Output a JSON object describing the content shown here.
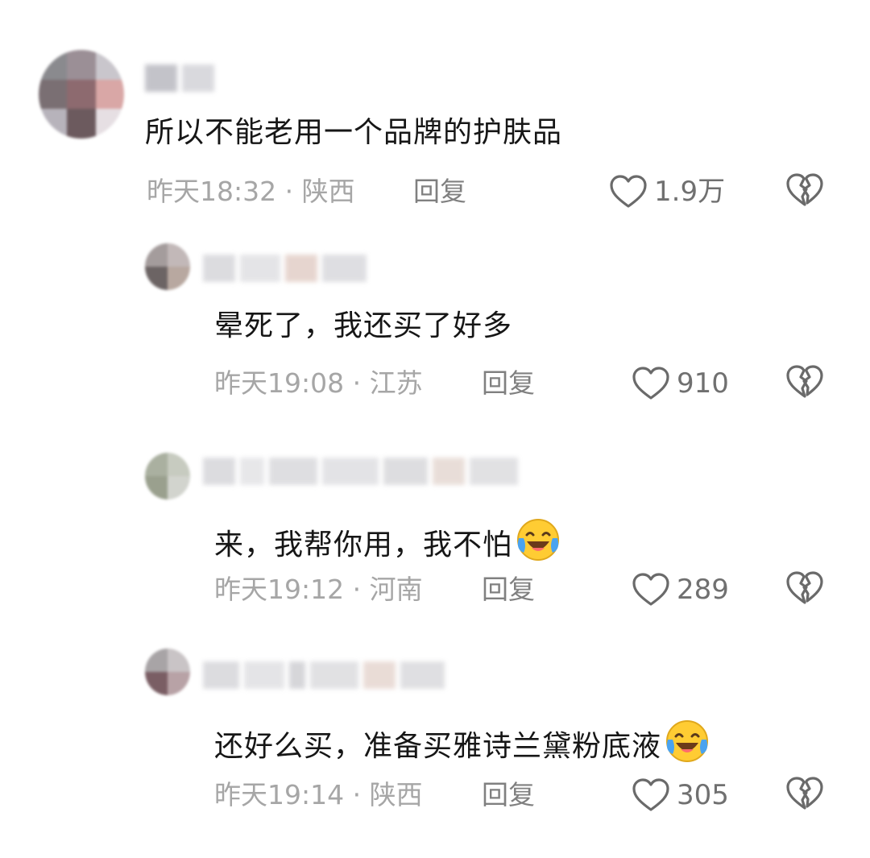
{
  "comments": [
    {
      "text": "所以不能老用一个品牌的护肤品",
      "time": "昨天18:32",
      "location": "陕西",
      "reply_label": "回复",
      "likes": "1.9万",
      "emoji": ""
    },
    {
      "text": "晕死了，我还买了好多",
      "time": "昨天19:08",
      "location": "江苏",
      "reply_label": "回复",
      "likes": "910",
      "emoji": ""
    },
    {
      "text": "来，我帮你用，我不怕",
      "time": "昨天19:12",
      "location": "河南",
      "reply_label": "回复",
      "likes": "289",
      "emoji": "laughing-tears-emoji"
    },
    {
      "text": "还好么买，准备买雅诗兰黛粉底液",
      "time": "昨天19:14",
      "location": "陕西",
      "reply_label": "回复",
      "likes": "305",
      "emoji": "laughing-tears-emoji"
    }
  ],
  "meta_separator": " · ",
  "icons": {
    "like": "heart-outline-icon",
    "dislike": "broken-heart-icon"
  },
  "colors": {
    "text": "#161616",
    "meta": "#a6a6a6",
    "reply": "#808080",
    "icon": "#6a6a6a"
  }
}
